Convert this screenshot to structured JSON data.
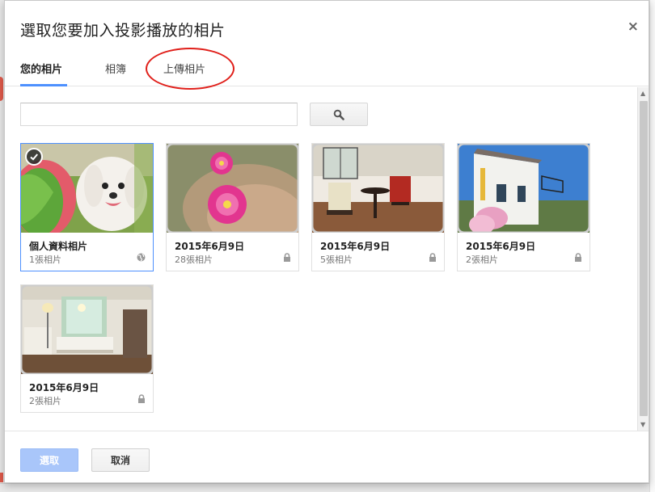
{
  "dialog": {
    "title": "選取您要加入投影播放的相片",
    "close_label": "×"
  },
  "tabs": [
    {
      "label": "您的相片",
      "active": true
    },
    {
      "label": "相簿",
      "active": false
    },
    {
      "label": "上傳相片",
      "active": false
    }
  ],
  "search": {
    "placeholder": "",
    "value": "",
    "button_icon": "search-icon"
  },
  "albums": [
    {
      "name": "個人資料相片",
      "count": "1張相片",
      "visibility": "globe-icon",
      "selected": true,
      "thumb": "dog-photo"
    },
    {
      "name": "2015年6月9日",
      "count": "28張相片",
      "visibility": "lock-icon",
      "selected": false,
      "thumb": "cactus-flower-photo"
    },
    {
      "name": "2015年6月9日",
      "count": "5張相片",
      "visibility": "lock-icon",
      "selected": false,
      "thumb": "dining-room-photo"
    },
    {
      "name": "2015年6月9日",
      "count": "2張相片",
      "visibility": "lock-icon",
      "selected": false,
      "thumb": "house-exterior-photo"
    },
    {
      "name": "2015年6月9日",
      "count": "2張相片",
      "visibility": "lock-icon",
      "selected": false,
      "thumb": "living-room-photo"
    }
  ],
  "footer": {
    "select_label": "選取",
    "cancel_label": "取消"
  },
  "colors": {
    "accent": "#4d90fe",
    "select_disabled": "#a9c6fa",
    "annotation": "#e0201b"
  }
}
